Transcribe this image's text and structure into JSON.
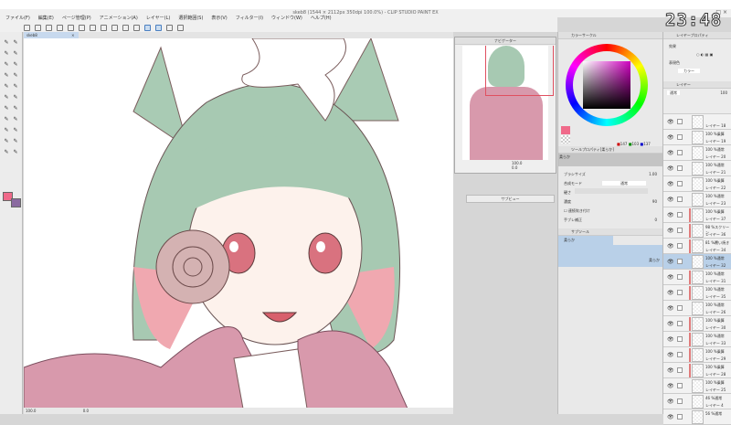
{
  "window": {
    "title": "skeb8 (1544 × 2112px 350dpi 100.0%) - CLIP STUDIO PAINT EX",
    "controls": "_ □ ×"
  },
  "clock": "23:48",
  "menu": [
    "ファイル(F)",
    "編集(E)",
    "ページ管理(P)",
    "アニメーション(A)",
    "レイヤー(L)",
    "選択範囲(S)",
    "表示(V)",
    "フィルター(I)",
    "ウィンドウ(W)",
    "ヘルプ(H)"
  ],
  "document_tab": {
    "label": "skeb8",
    "close": "×"
  },
  "status": {
    "zoom": "100.0",
    "angle": "0.0"
  },
  "navigator": {
    "title": "ナビゲーター",
    "zoom": "100.0",
    "angle": "0.0"
  },
  "subview": {
    "title": "サブビュー"
  },
  "color": {
    "title": "カラーサークル",
    "main": "#f06a8a",
    "sub": "#8a6aa0",
    "r": "147",
    "g": "103",
    "b": "137"
  },
  "tool_property": {
    "title": "ツールプロパティ[柔らか]",
    "brush": "柔らか",
    "brush_size_label": "ブラシサイズ",
    "brush_size": "1.00",
    "blend_label": "合成モード",
    "blend": "通常",
    "hardness_label": "硬さ",
    "density_label": "濃度",
    "density": "90",
    "continuous": "連続吹き付け",
    "stabilize_label": "手ブレ補正",
    "stabilize": "0"
  },
  "subtool": {
    "title": "サブツール",
    "selected": "柔らか",
    "preview_label": "柔らか"
  },
  "layer_property": {
    "title": "レイヤープロパティ",
    "effect_label": "効果",
    "expression_label": "表現色",
    "expression": "カラー"
  },
  "layer_panel": {
    "title": "レイヤー",
    "blend": "通常",
    "opacity": "100"
  },
  "layers": [
    {
      "mode": "",
      "name": "レイヤー 18",
      "bar": false,
      "sel": false
    },
    {
      "mode": "100 %乗算",
      "name": "レイヤー 19",
      "bar": false,
      "sel": false
    },
    {
      "mode": "100 %通常",
      "name": "レイヤー 20",
      "bar": false,
      "sel": false
    },
    {
      "mode": "100 %通常",
      "name": "レイヤー 21",
      "bar": false,
      "sel": false
    },
    {
      "mode": "100 %乗算",
      "name": "レイヤー 22",
      "bar": false,
      "sel": false
    },
    {
      "mode": "100 %通常",
      "name": "レイヤー 23",
      "bar": false,
      "sel": false
    },
    {
      "mode": "100 %乗算",
      "name": "レイヤー 37",
      "bar": true,
      "sel": false
    },
    {
      "mode": "98 %スクリーン",
      "name": "レイヤー 36",
      "bar": true,
      "sel": false
    },
    {
      "mode": "81 %覆い焼き",
      "name": "レイヤー 34",
      "bar": true,
      "sel": false
    },
    {
      "mode": "100 %通常",
      "name": "レイヤー 32",
      "bar": false,
      "sel": true
    },
    {
      "mode": "100 %通常",
      "name": "レイヤー 31",
      "bar": true,
      "sel": false
    },
    {
      "mode": "100 %通常",
      "name": "レイヤー 35",
      "bar": true,
      "sel": false
    },
    {
      "mode": "100 %通常",
      "name": "レイヤー 26",
      "bar": false,
      "sel": false
    },
    {
      "mode": "100 %乗算",
      "name": "レイヤー 30",
      "bar": true,
      "sel": false
    },
    {
      "mode": "100 %通常",
      "name": "レイヤー 33",
      "bar": true,
      "sel": false
    },
    {
      "mode": "100 %乗算",
      "name": "レイヤー 29",
      "bar": true,
      "sel": false
    },
    {
      "mode": "100 %乗算",
      "name": "レイヤー 28",
      "bar": true,
      "sel": false
    },
    {
      "mode": "100 %乗算",
      "name": "レイヤー 25",
      "bar": false,
      "sel": false
    },
    {
      "mode": "46 %通常",
      "name": "レイヤー 4",
      "bar": false,
      "sel": false
    },
    {
      "mode": "56 %通常",
      "name": "",
      "bar": false,
      "sel": false
    }
  ]
}
